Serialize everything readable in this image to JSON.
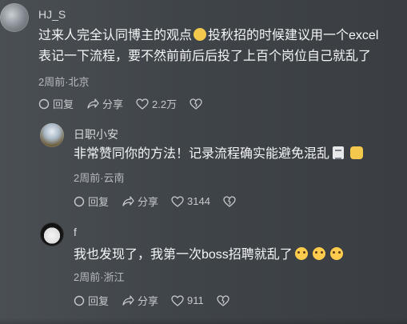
{
  "comments": [
    {
      "author": "HJ_S",
      "text_line1_a": "过来人完全认同博主的观点",
      "text_line1_b": "投秋招的时候建议用一个excel",
      "text_line2": "表记一下流程，要不然前前后后投了上百个岗位自己就乱了",
      "meta": "2周前·北京",
      "reply_label": "回复",
      "share_label": "分享",
      "like_count": "2.2万"
    },
    {
      "author": "日职小安",
      "text": "非常赞同你的方法！记录流程确实能避免混乱",
      "meta": "2周前·云南",
      "reply_label": "回复",
      "share_label": "分享",
      "like_count": "3144"
    },
    {
      "author": "f",
      "text": "我也发现了，我第一次boss招聘就乱了",
      "meta": "2周前·浙江",
      "reply_label": "回复",
      "share_label": "分享",
      "like_count": "911"
    }
  ],
  "icons": {
    "reply": "reply-icon",
    "share": "share-icon",
    "like": "heart-icon",
    "dislike": "dislike-icon"
  }
}
